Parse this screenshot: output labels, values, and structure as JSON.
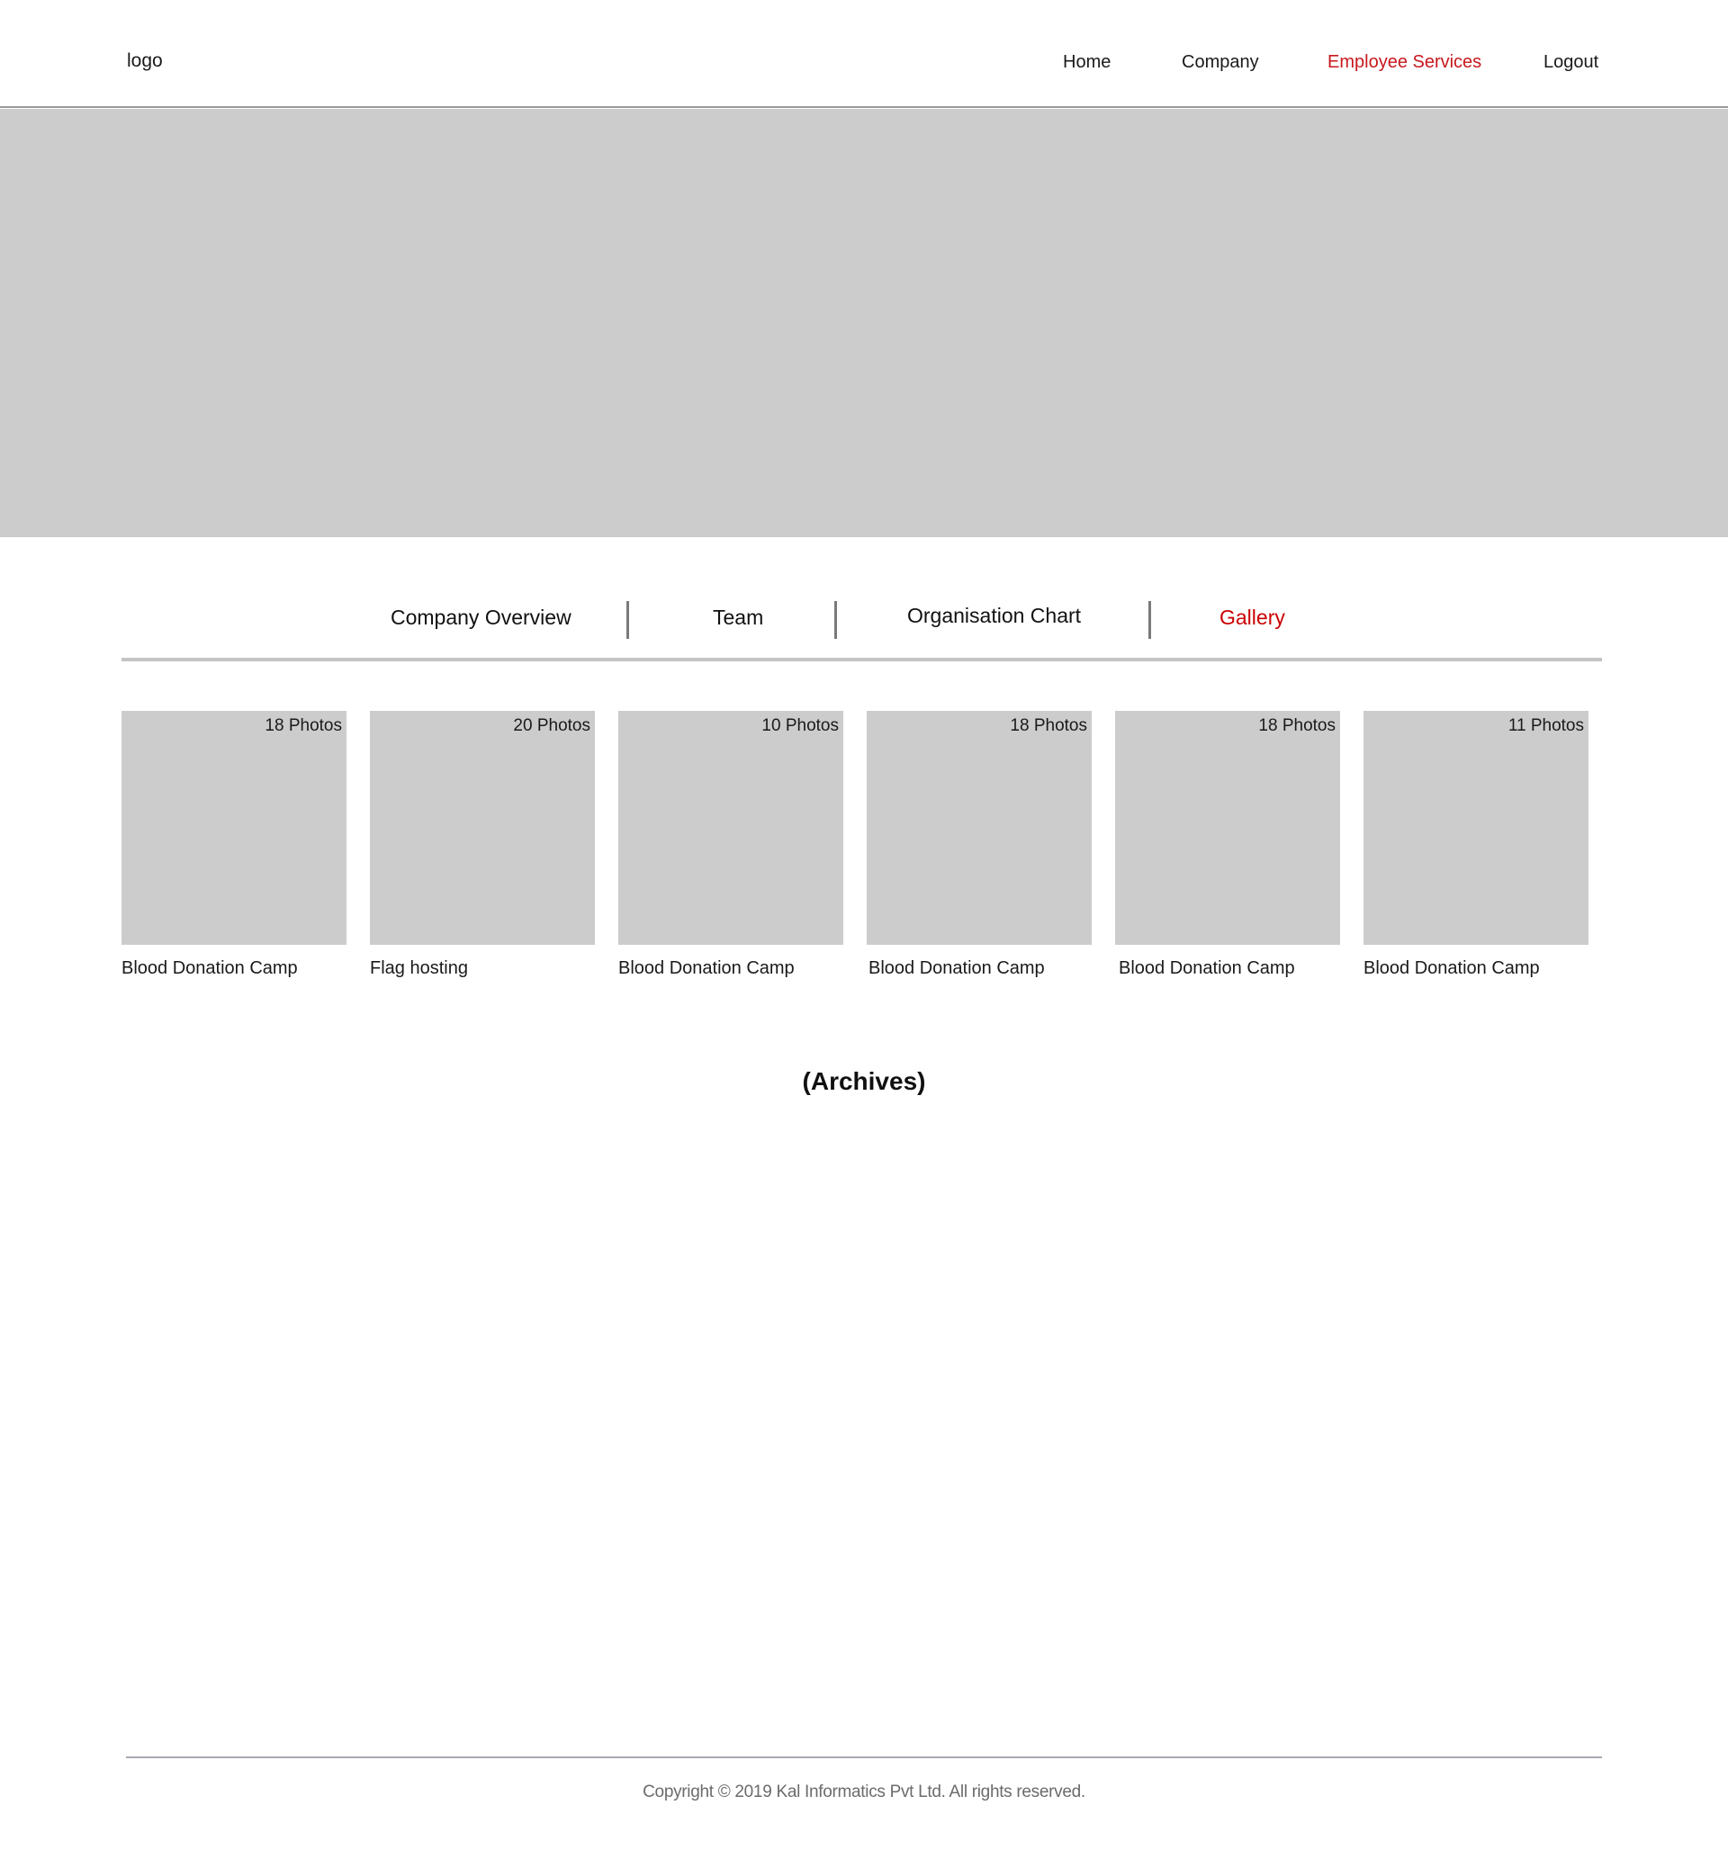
{
  "header": {
    "logo": "logo",
    "nav": {
      "home": "Home",
      "company": "Company",
      "employee_services": "Employee Services",
      "logout": "Logout"
    },
    "active_nav": "Employee Services"
  },
  "tabs": {
    "company_overview": "Company Overview",
    "team": "Team",
    "organisation_chart": "Organisation Chart",
    "gallery": "Gallery",
    "active_tab": "Gallery"
  },
  "gallery": {
    "albums": [
      {
        "count": "18 Photos",
        "title": "Blood Donation Camp"
      },
      {
        "count": "20 Photos",
        "title": "Flag hosting"
      },
      {
        "count": "10 Photos",
        "title": "Blood Donation Camp"
      },
      {
        "count": "18 Photos",
        "title": "Blood Donation Camp"
      },
      {
        "count": "18 Photos",
        "title": "Blood Donation Camp"
      },
      {
        "count": "11 Photos",
        "title": "Blood Donation Camp"
      }
    ],
    "archives_label": "(Archives)"
  },
  "footer": {
    "copyright": "Copyright © 2019 Kal Informatics Pvt Ltd. All rights reserved."
  },
  "colors": {
    "accent": "#c8181e",
    "placeholder": "#cccccc",
    "rule": "#c4c4c4"
  }
}
